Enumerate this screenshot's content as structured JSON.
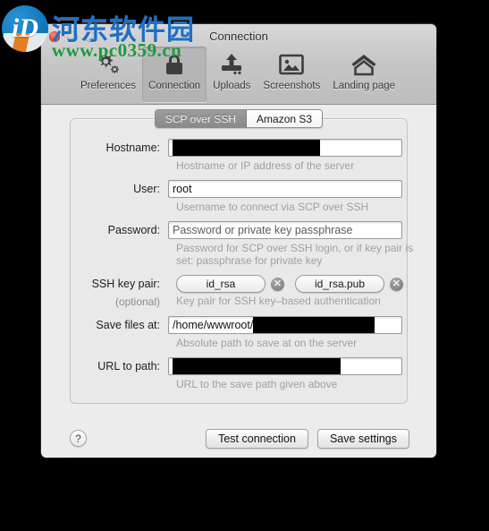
{
  "watermark": {
    "logo_glyph": "iD",
    "site_name": "河东软件园",
    "site_url": "www.pc0359.cn"
  },
  "window": {
    "title": "Connection",
    "traffic_lights": [
      "close",
      "minimize",
      "zoom"
    ]
  },
  "toolbar": {
    "items": [
      {
        "label": "Preferences",
        "icon": "gears-icon",
        "selected": false
      },
      {
        "label": "Connection",
        "icon": "lock-icon",
        "selected": true
      },
      {
        "label": "Uploads",
        "icon": "upload-icon",
        "selected": false
      },
      {
        "label": "Screenshots",
        "icon": "image-icon",
        "selected": false
      },
      {
        "label": "Landing page",
        "icon": "home-icon",
        "selected": false
      }
    ]
  },
  "tabs": {
    "items": [
      {
        "label": "SCP over SSH",
        "selected": true
      },
      {
        "label": "Amazon S3",
        "selected": false
      }
    ]
  },
  "form": {
    "hostname": {
      "label": "Hostname:",
      "value": "",
      "redacted": true,
      "redact_width": 165,
      "hint": "Hostname or IP address of the server"
    },
    "user": {
      "label": "User:",
      "value": "root",
      "hint": "Username to connect via SCP over SSH"
    },
    "password": {
      "label": "Password:",
      "value": "",
      "placeholder": "Password or private key passphrase",
      "hint": "Password for SCP over SSH login, or if key pair is set: passphrase for private key"
    },
    "ssh_key_pair": {
      "label": "SSH key pair:",
      "sublabel": "(optional)",
      "private_key": "id_rsa",
      "public_key": "id_rsa.pub",
      "clear_glyph": "✕",
      "hint": "Key pair for SSH key–based authentication"
    },
    "save_files_at": {
      "label": "Save files at:",
      "value": "/home/wwwroot/",
      "redacted": true,
      "redact_width": 136,
      "hint": "Absolute path to save at on the server"
    },
    "url_to_path": {
      "label": "URL to path:",
      "value": "",
      "redacted": true,
      "redact_width": 188,
      "hint": "URL to the save path given above"
    }
  },
  "footer": {
    "help_glyph": "?",
    "test_connection_label": "Test connection",
    "save_settings_label": "Save settings"
  },
  "colors": {
    "window_bg": "#ececec",
    "chrome_top": "#d8d8d8",
    "chrome_bottom": "#bdbdbd",
    "hint_text": "#a0a0a0",
    "accent_blue": "#1f6fc4",
    "accent_green": "#1c9a3c",
    "desktop": "#000000"
  }
}
